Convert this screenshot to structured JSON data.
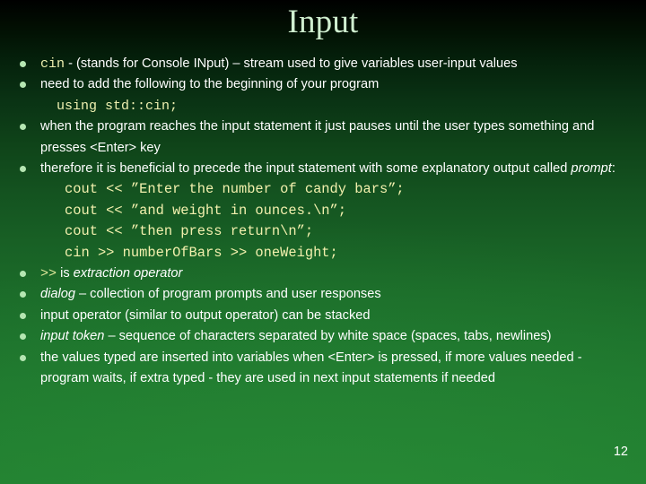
{
  "slide": {
    "title": "Input",
    "page_number": "12",
    "accent_color": "#b5e6b2",
    "code_color": "#f2f0ad",
    "text_color": "#ffffff",
    "background_top_color": "#000000",
    "background_bottom_color": "#217f30"
  },
  "bullets": [
    {
      "id": "cin-definition",
      "code_prefix": "cin",
      "text": " - (stands for Console INput) – stream used to give variables user-input values"
    },
    {
      "id": "using-declaration",
      "text": "need to add the following to the beginning of your program",
      "sub_code": "using std::cin;"
    },
    {
      "id": "program-pauses",
      "text": "when the program reaches the input statement it just pauses until the user types something and presses <Enter> key"
    },
    {
      "id": "prompt-explanation",
      "text_before": "therefore it is beneficial to precede the input statement with some explanatory output called ",
      "italic": "prompt",
      "text_after": ":"
    },
    {
      "id": "extraction-operator",
      "code_prefix": ">>",
      "text_plain": " is ",
      "italic": "extraction operator"
    },
    {
      "id": "dialog-definition",
      "italic": "dialog",
      "text_after": " – collection of program prompts and user responses"
    },
    {
      "id": "stacking",
      "text": "input operator (similar to output operator) can be stacked"
    },
    {
      "id": "input-token",
      "italic": "input token",
      "text_after": " – sequence of characters separated by white space (spaces, tabs, newlines)"
    },
    {
      "id": "values-inserted",
      "text": "the values typed are inserted into variables when <Enter> is pressed, if more values needed - program waits, if extra typed - they are used in next input statements if needed"
    }
  ],
  "code_block": {
    "lines": [
      "cout << ”Enter the number of candy bars”;",
      "cout << ”and weight in ounces.\\n”;",
      "cout << ”then press return\\n”;",
      "cin >> numberOfBars >> oneWeight;"
    ]
  }
}
